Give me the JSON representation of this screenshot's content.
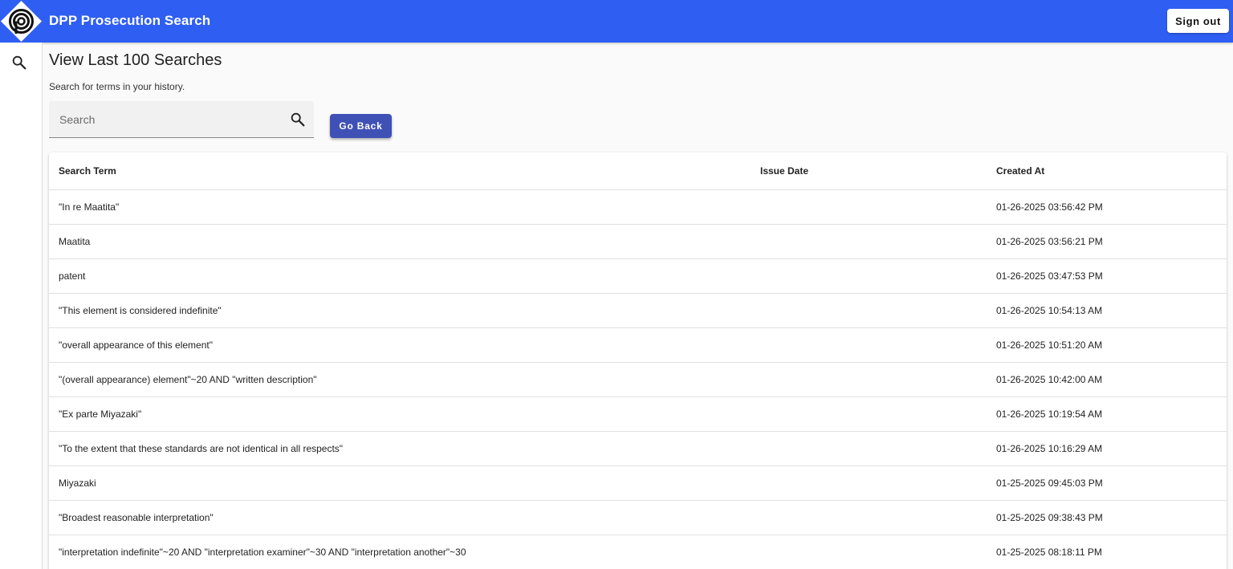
{
  "app": {
    "title": "DPP Prosecution Search",
    "sign_out_label": "Sign out",
    "brand_color": "#2f5ef2"
  },
  "sidebar": {
    "items": [
      {
        "icon": "search-icon"
      }
    ]
  },
  "page": {
    "heading": "View Last 100 Searches",
    "subtitle": "Search for terms in your history.",
    "search_placeholder": "Search",
    "go_back_label": "Go Back"
  },
  "table": {
    "columns": [
      "Search Term",
      "Issue Date",
      "Created At"
    ],
    "rows": [
      {
        "term": "\"In re Maatita\"",
        "issue_date": "",
        "created_at": "01-26-2025 03:56:42 PM"
      },
      {
        "term": "Maatita",
        "issue_date": "",
        "created_at": "01-26-2025 03:56:21 PM"
      },
      {
        "term": "patent",
        "issue_date": "",
        "created_at": "01-26-2025 03:47:53 PM"
      },
      {
        "term": "\"This element is considered indefinite\"",
        "issue_date": "",
        "created_at": "01-26-2025 10:54:13 AM"
      },
      {
        "term": "\"overall appearance of this element\"",
        "issue_date": "",
        "created_at": "01-26-2025 10:51:20 AM"
      },
      {
        "term": "\"(overall appearance) element\"~20 AND \"written description\"",
        "issue_date": "",
        "created_at": "01-26-2025 10:42:00 AM"
      },
      {
        "term": "\"Ex parte Miyazaki\"",
        "issue_date": "",
        "created_at": "01-26-2025 10:19:54 AM"
      },
      {
        "term": "\"To the extent that these standards are not identical in all respects\"",
        "issue_date": "",
        "created_at": "01-26-2025 10:16:29 AM"
      },
      {
        "term": "Miyazaki",
        "issue_date": "",
        "created_at": "01-25-2025 09:45:03 PM"
      },
      {
        "term": "\"Broadest reasonable interpretation\"",
        "issue_date": "",
        "created_at": "01-25-2025 09:38:43 PM"
      },
      {
        "term": "\"interpretation indefinite\"~20 AND \"interpretation examiner\"~30 AND \"interpretation another\"~30",
        "issue_date": "",
        "created_at": "01-25-2025 08:18:11 PM"
      }
    ]
  }
}
